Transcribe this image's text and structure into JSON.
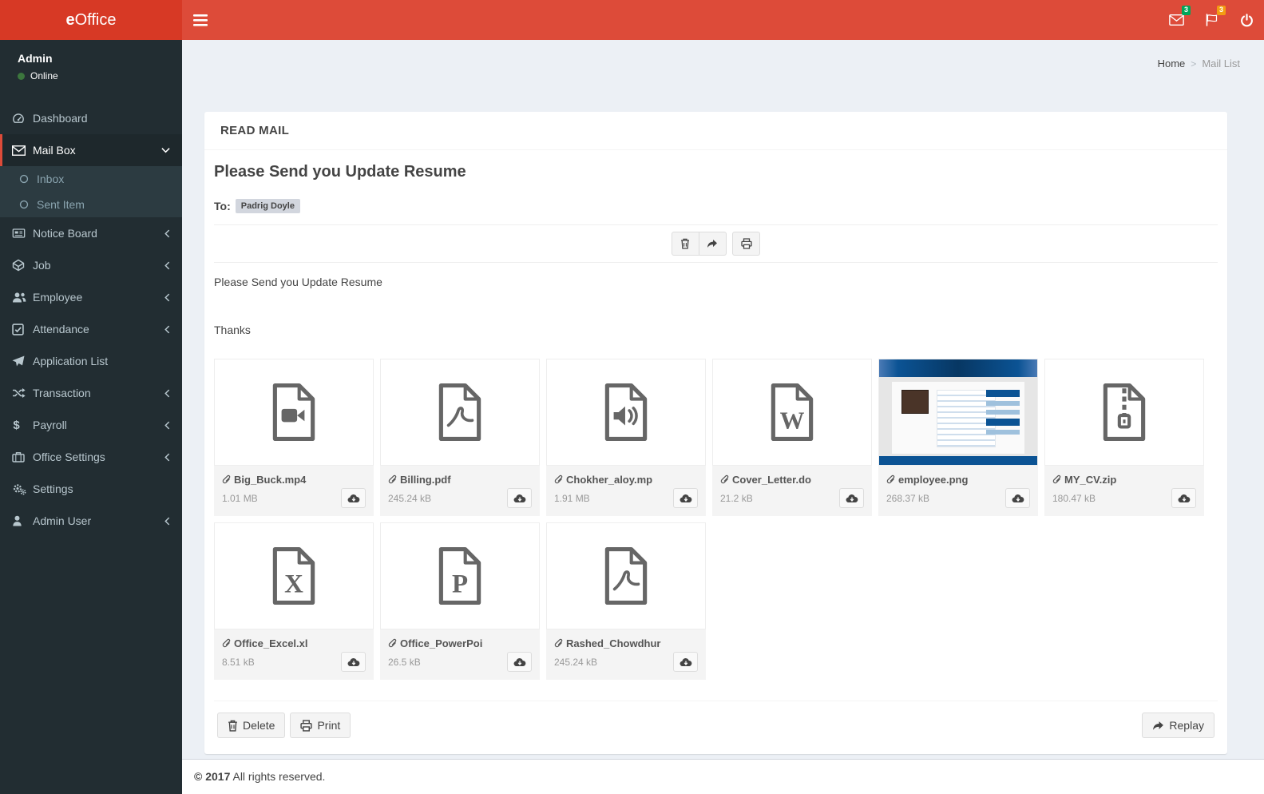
{
  "header": {
    "logo_accent": "e",
    "logo_rest": "Office",
    "messages_badge": "3",
    "notifications_badge": "3"
  },
  "breadcrumb": {
    "home": "Home",
    "separator": ">",
    "current": "Mail List"
  },
  "sidebar": {
    "user_name": "Admin",
    "user_status": "Online",
    "items": [
      {
        "label": "Dashboard"
      },
      {
        "label": "Mail Box"
      },
      {
        "label": "Inbox"
      },
      {
        "label": "Sent Item"
      },
      {
        "label": "Notice Board"
      },
      {
        "label": "Job"
      },
      {
        "label": "Employee"
      },
      {
        "label": "Attendance"
      },
      {
        "label": "Application List"
      },
      {
        "label": "Transaction"
      },
      {
        "label": "Payroll"
      },
      {
        "label": "Office Settings"
      },
      {
        "label": "Settings"
      },
      {
        "label": "Admin User"
      }
    ]
  },
  "mail": {
    "panel_title": "READ MAIL",
    "subject": "Please Send you Update Resume",
    "to_label": "To:",
    "recipient": "Padrig Doyle",
    "body_line1": "Please Send you Update Resume",
    "body_line2": "Thanks",
    "actions": {
      "delete": "Delete",
      "print": "Print",
      "replay": "Replay"
    }
  },
  "attachments": [
    {
      "name": "Big_Buck.mp4",
      "size": "1.01 MB",
      "type": "video"
    },
    {
      "name": "Billing.pdf",
      "size": "245.24 kB",
      "type": "pdf"
    },
    {
      "name": "Chokher_aloy.mp",
      "size": "1.91 MB",
      "type": "audio"
    },
    {
      "name": "Cover_Letter.do",
      "size": "21.2 kB",
      "type": "word"
    },
    {
      "name": "employee.png",
      "size": "268.37 kB",
      "type": "image"
    },
    {
      "name": "MY_CV.zip",
      "size": "180.47 kB",
      "type": "zip"
    },
    {
      "name": "Office_Excel.xl",
      "size": "8.51 kB",
      "type": "excel"
    },
    {
      "name": "Office_PowerPoi",
      "size": "26.5 kB",
      "type": "powerpoint"
    },
    {
      "name": "Rashed_Chowdhur",
      "size": "245.24 kB",
      "type": "pdf"
    }
  ],
  "footer": {
    "copyright_bold": "© 2017",
    "copyright_rest": "All rights reserved."
  },
  "colors": {
    "accent": "#dd4b39",
    "logo_bg": "#d73925",
    "sidebar_bg": "#222d32",
    "badge_green": "#00a65a",
    "badge_yellow": "#f39c12",
    "online_green": "#3c763d"
  }
}
